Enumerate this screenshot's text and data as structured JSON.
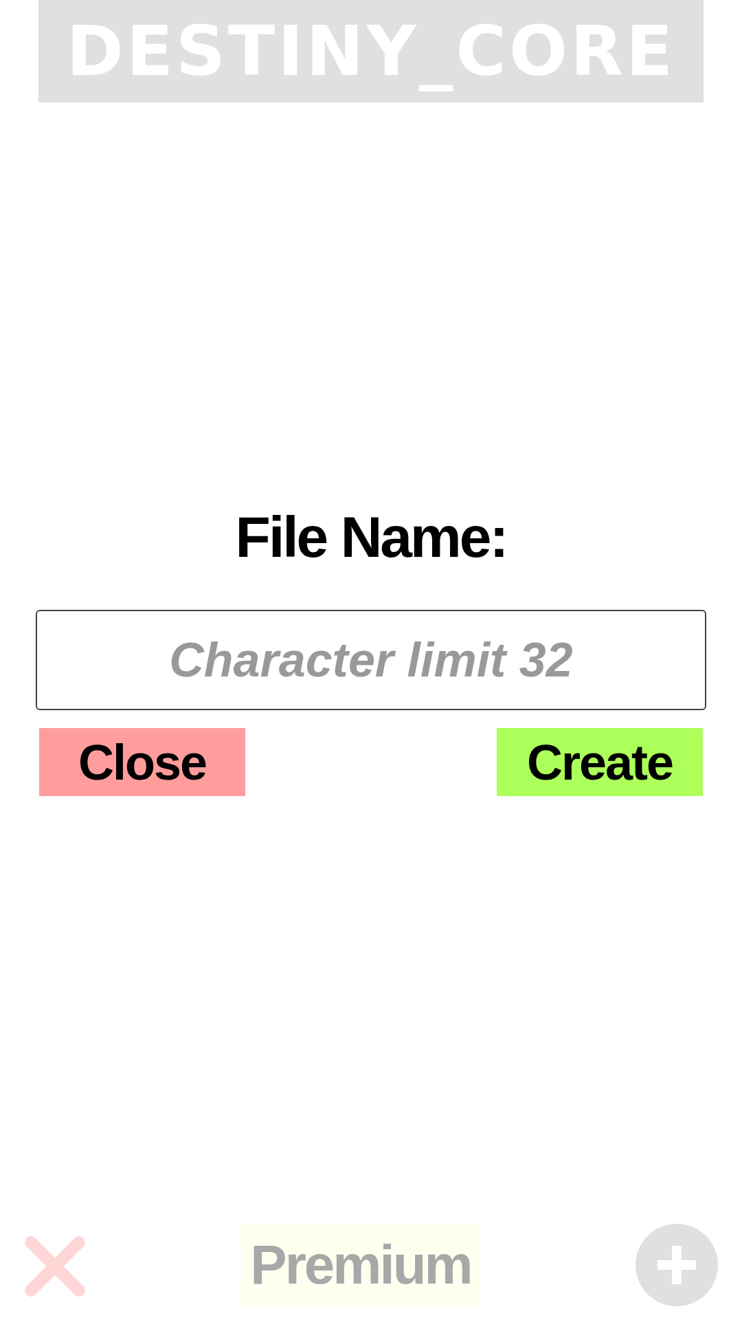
{
  "header": {
    "title": "DESTINY_CORE"
  },
  "dialog": {
    "label": "File Name:",
    "field": {
      "placeholder": "Character limit 32"
    },
    "buttons": [
      {
        "kind": "close",
        "label": "Close"
      },
      {
        "kind": "create",
        "label": "Create"
      }
    ]
  },
  "bottom_bar": {
    "premium": {
      "label": "Premium"
    }
  }
}
